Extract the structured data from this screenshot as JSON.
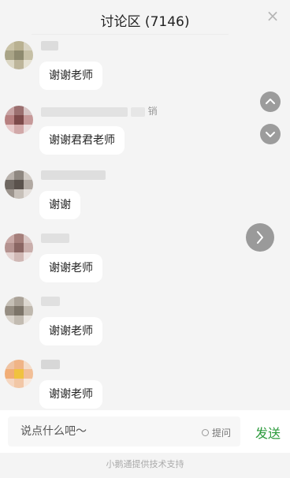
{
  "header": {
    "title": "讨论区 (7146)",
    "close_label": "×"
  },
  "messages": [
    {
      "name_visible": "",
      "text": "谢谢老师"
    },
    {
      "name_visible": "销",
      "text": "谢谢君君老师"
    },
    {
      "name_visible": "",
      "text": "谢谢"
    },
    {
      "name_visible": "",
      "text": "谢谢老师"
    },
    {
      "name_visible": "",
      "text": "谢谢老师"
    },
    {
      "name_visible": "",
      "text": "谢谢老师"
    }
  ],
  "composer": {
    "placeholder": "说点什么吧～",
    "ask_label": "提问",
    "send_label": "发送"
  },
  "footer": {
    "text": "小鹅通提供技术支持"
  },
  "colors": {
    "send": "#2a9a3b",
    "bubble": "#ffffff",
    "background": "#f4f4f4",
    "fab": "#9c9c9c"
  },
  "icons": [
    "close-icon",
    "chevron-up-icon",
    "chevron-down-icon",
    "chevron-right-icon",
    "radio-icon"
  ]
}
